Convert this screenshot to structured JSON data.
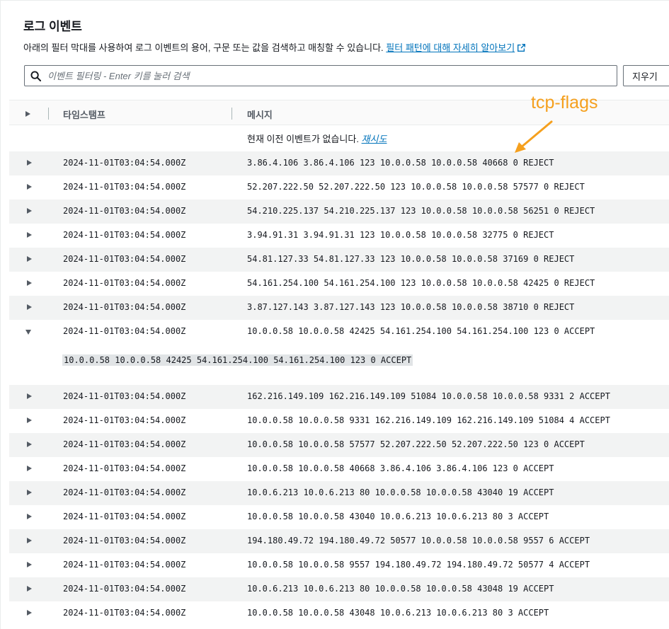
{
  "header": {
    "title": "로그 이벤트",
    "description": "아래의 필터 막대를 사용하여 로그 이벤트의 용어, 구문 또는 값을 검색하고 매칭할 수 있습니다.",
    "learn_more_link": "필터 패턴에 대해 자세히 알아보기"
  },
  "search": {
    "placeholder": "이벤트 필터링 - Enter 키를 눌러 검색",
    "value": "",
    "clear_label": "지우기"
  },
  "table": {
    "columns": [
      "타임스탬프",
      "메시지"
    ],
    "notice_text": "현재 이전 이벤트가 없습니다.",
    "notice_link": "재시도",
    "rows_before": [
      {
        "timestamp": "2024-11-01T03:04:54.000Z",
        "message": "3.86.4.106 3.86.4.106 123 10.0.0.58 10.0.0.58 40668 0 REJECT"
      },
      {
        "timestamp": "2024-11-01T03:04:54.000Z",
        "message": "52.207.222.50 52.207.222.50 123 10.0.0.58 10.0.0.58 57577 0 REJECT"
      },
      {
        "timestamp": "2024-11-01T03:04:54.000Z",
        "message": "54.210.225.137 54.210.225.137 123 10.0.0.58 10.0.0.58 56251 0 REJECT"
      },
      {
        "timestamp": "2024-11-01T03:04:54.000Z",
        "message": "3.94.91.31 3.94.91.31 123 10.0.0.58 10.0.0.58 32775 0 REJECT"
      },
      {
        "timestamp": "2024-11-01T03:04:54.000Z",
        "message": "54.81.127.33 54.81.127.33 123 10.0.0.58 10.0.0.58 37169 0 REJECT"
      },
      {
        "timestamp": "2024-11-01T03:04:54.000Z",
        "message": "54.161.254.100 54.161.254.100 123 10.0.0.58 10.0.0.58 42425 0 REJECT"
      },
      {
        "timestamp": "2024-11-01T03:04:54.000Z",
        "message": "3.87.127.143 3.87.127.143 123 10.0.0.58 10.0.0.58 38710 0 REJECT"
      }
    ],
    "expanded_row": {
      "timestamp": "2024-11-01T03:04:54.000Z",
      "message": "10.0.0.58 10.0.0.58 42425 54.161.254.100 54.161.254.100 123 0 ACCEPT",
      "detail": "10.0.0.58 10.0.0.58 42425 54.161.254.100 54.161.254.100 123 0 ACCEPT"
    },
    "rows_after": [
      {
        "timestamp": "2024-11-01T03:04:54.000Z",
        "message": "162.216.149.109 162.216.149.109 51084 10.0.0.58 10.0.0.58 9331 2 ACCEPT"
      },
      {
        "timestamp": "2024-11-01T03:04:54.000Z",
        "message": "10.0.0.58 10.0.0.58 9331 162.216.149.109 162.216.149.109 51084 4 ACCEPT"
      },
      {
        "timestamp": "2024-11-01T03:04:54.000Z",
        "message": "10.0.0.58 10.0.0.58 57577 52.207.222.50 52.207.222.50 123 0 ACCEPT"
      },
      {
        "timestamp": "2024-11-01T03:04:54.000Z",
        "message": "10.0.0.58 10.0.0.58 40668 3.86.4.106 3.86.4.106 123 0 ACCEPT"
      },
      {
        "timestamp": "2024-11-01T03:04:54.000Z",
        "message": "10.0.6.213 10.0.6.213 80 10.0.0.58 10.0.0.58 43040 19 ACCEPT"
      },
      {
        "timestamp": "2024-11-01T03:04:54.000Z",
        "message": "10.0.0.58 10.0.0.58 43040 10.0.6.213 10.0.6.213 80 3 ACCEPT"
      },
      {
        "timestamp": "2024-11-01T03:04:54.000Z",
        "message": "194.180.49.72 194.180.49.72 50577 10.0.0.58 10.0.0.58 9557 6 ACCEPT"
      },
      {
        "timestamp": "2024-11-01T03:04:54.000Z",
        "message": "10.0.0.58 10.0.0.58 9557 194.180.49.72 194.180.49.72 50577 4 ACCEPT"
      },
      {
        "timestamp": "2024-11-01T03:04:54.000Z",
        "message": "10.0.6.213 10.0.6.213 80 10.0.0.58 10.0.0.58 43048 19 ACCEPT"
      },
      {
        "timestamp": "2024-11-01T03:04:54.000Z",
        "message": "10.0.0.58 10.0.0.58 43048 10.0.6.213 10.0.6.213 80 3 ACCEPT"
      }
    ]
  },
  "annotation": {
    "label": "tcp-flags",
    "color": "#f5a01e"
  },
  "colors": {
    "link": "#0073bb",
    "row_shade": "#f2f3f3",
    "border": "#eaeded"
  },
  "icons": {
    "search": "search-icon",
    "external_link": "external-link-icon",
    "expand": "caret-right-icon",
    "collapse": "caret-down-icon"
  }
}
